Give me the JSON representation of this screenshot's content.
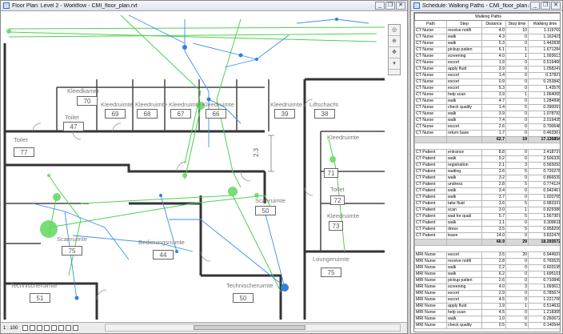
{
  "floorplan": {
    "title": "Floor Plan: Level 2 - Workflow - CMI_floor_plan.rvt",
    "scale": "1 : 100",
    "rooms": [
      {
        "name": "Kleedkamer",
        "number": "70"
      },
      {
        "name": "Kleedruimte",
        "number": "69"
      },
      {
        "name": "Kleedruimte",
        "number": "68"
      },
      {
        "name": "Kleedruimte",
        "number": "67"
      },
      {
        "name": "Kleedruimte",
        "number": "66"
      },
      {
        "name": "Kleedruimte",
        "number": "39"
      },
      {
        "name": "Liftschacht",
        "number": "38"
      },
      {
        "name": "Toilet",
        "number": "47"
      },
      {
        "name": "Toilet",
        "number": "77"
      },
      {
        "name": "Kleedruimte",
        "number": "71"
      },
      {
        "name": "Toilet",
        "number": "72"
      },
      {
        "name": "Kleedruimte",
        "number": "73"
      },
      {
        "name": "Scanruimte",
        "number": "75"
      },
      {
        "name": "Scanruimte",
        "number": "50"
      },
      {
        "name": "Bedieningsruimte",
        "number": "44"
      },
      {
        "name": "Loungeruimte",
        "number": "75"
      },
      {
        "name": "Technischeruimte",
        "number": "51"
      },
      {
        "name": "Technischeruimte",
        "number": "50"
      }
    ],
    "dimension": "2.3",
    "controls": {
      "title_icon": "revit-view-icon",
      "minimize": "_",
      "restore": "❐",
      "close": "✕"
    }
  },
  "schedule": {
    "title": "Schedule: Walking Paths - CMI_floor_plan.rvt",
    "caption": "Walking Paths",
    "columns": [
      "Path",
      "Step",
      "Distance",
      "Stop time",
      "Walking time"
    ],
    "groups": [
      {
        "rows": [
          [
            "CT Nurse",
            "receive notifi",
            "4.0",
            "10",
            "1.119769"
          ],
          [
            "CT Nurse",
            "walk",
            "4.3",
            "0",
            "1.162421"
          ],
          [
            "CT Nurse",
            "walk",
            "5.3",
            "0",
            "1.442838"
          ],
          [
            "CT Nurse",
            "pickup patien",
            "6.1",
            "1",
            "1.671284"
          ],
          [
            "CT Nurse",
            "screening",
            "4.0",
            "1",
            "1.093613"
          ],
          [
            "CT Nurse",
            "escort",
            "1.9",
            "0",
            "0.519466"
          ],
          [
            "CT Nurse",
            "apply fluid",
            "3.9",
            "0",
            "1.058247"
          ],
          [
            "CT Nurse",
            "escort",
            "1.4",
            "0",
            "0.37827"
          ],
          [
            "CT Nurse",
            "escort",
            "0.9",
            "0",
            "0.253843"
          ],
          [
            "CT Nurse",
            "escort",
            "5.3",
            "0",
            "1.43576"
          ],
          [
            "CT Nurse",
            "help scan",
            "3.9",
            "1",
            "1.064065"
          ],
          [
            "CT Nurse",
            "walk",
            "4.7",
            "0",
            "1.284996"
          ],
          [
            "CT Nurse",
            "check quality",
            "1.4",
            "5",
            "0.390097"
          ],
          [
            "CT Nurse",
            "walk",
            "3.9",
            "0",
            "1.078793"
          ],
          [
            "CT Nurse",
            "walk",
            "7.4",
            "0",
            "2.019435"
          ],
          [
            "CT Nurse",
            "escort",
            "2.6",
            "0",
            "0.700648"
          ],
          [
            "CT Nurse",
            "return base",
            "1.7",
            "0",
            "0.463307"
          ]
        ],
        "total": [
          "",
          "",
          "62.7",
          "19",
          "17.136854"
        ]
      },
      {
        "rows": [
          [
            "CT Patient",
            "entrance",
            "8.8",
            "0",
            "2.418737"
          ],
          [
            "CT Patient",
            "walk",
            "9.2",
            "0",
            "2.506339"
          ],
          [
            "CT Patient",
            "registration",
            "2.1",
            "3",
            "0.565093"
          ],
          [
            "CT Patient",
            "waiting",
            "2.6",
            "5",
            "0.720278"
          ],
          [
            "CT Patient",
            "walk",
            "3.2",
            "0",
            "0.866539"
          ],
          [
            "CT Patient",
            "undress",
            "2.8",
            "5",
            "0.774124"
          ],
          [
            "CT Patient",
            "walk",
            "3.4",
            "0",
            "0.942467"
          ],
          [
            "CT Patient",
            "walk",
            "3.7",
            "0",
            "1.020765"
          ],
          [
            "CT Patient",
            "take fluid",
            "3.6",
            "5",
            "0.983337"
          ],
          [
            "CT Patient",
            "scan",
            "3.0",
            "1",
            "0.829386"
          ],
          [
            "CT Patient",
            "wait for quali",
            "5.7",
            "5",
            "1.567307"
          ],
          [
            "CT Patient",
            "walk",
            "1.1",
            "0",
            "0.308611"
          ],
          [
            "CT Patient",
            "dress",
            "3.5",
            "5",
            "0.958206"
          ],
          [
            "CT Patient",
            "leave",
            "14.0",
            "0",
            "3.832476"
          ]
        ],
        "total": [
          "",
          "",
          "66.9",
          "29",
          "18.293572"
        ]
      },
      {
        "rows": [
          [
            "MRI Nurse",
            "escort",
            "3.5",
            "20",
            "0.944937"
          ],
          [
            "MRI Nurse",
            "receive notifi",
            "2.8",
            "0",
            "0.765529"
          ],
          [
            "MRI Nurse",
            "walk",
            "2.2",
            "0",
            "0.603195"
          ],
          [
            "MRI Nurse",
            "walk",
            "6.2",
            "0",
            "1.695101"
          ],
          [
            "MRI Nurse",
            "pickup patien",
            "2.6",
            "0",
            "0.710849"
          ],
          [
            "MRI Nurse",
            "screening",
            "4.0",
            "3",
            "1.093613"
          ],
          [
            "MRI Nurse",
            "escort",
            "2.9",
            "0",
            "0.785674"
          ],
          [
            "MRI Nurse",
            "escort",
            "4.5",
            "0",
            "1.221706"
          ],
          [
            "MRI Nurse",
            "apply fluid",
            "1.9",
            "1",
            "0.514632"
          ],
          [
            "MRI Nurse",
            "help scan",
            "4.5",
            "0",
            "1.218305"
          ],
          [
            "MRI Nurse",
            "walk",
            "1.0",
            "0",
            "0.260672"
          ],
          [
            "MRI Nurse",
            "check quality",
            "0.5",
            "5",
            "0.140544"
          ]
        ]
      }
    ]
  }
}
